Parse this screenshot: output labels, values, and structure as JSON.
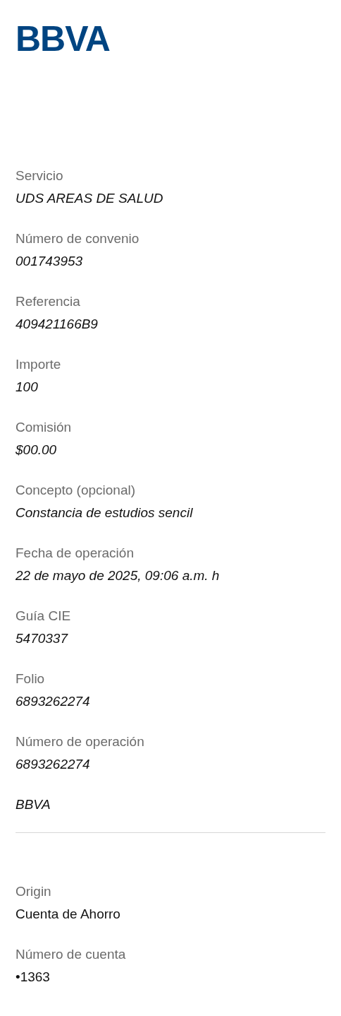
{
  "logo": "BBVA",
  "details": [
    {
      "label": "Servicio",
      "value": "UDS AREAS DE SALUD"
    },
    {
      "label": "Número de convenio",
      "value": "001743953"
    },
    {
      "label": "Referencia",
      "value": "409421166B9"
    },
    {
      "label": "Importe",
      "value": "100"
    },
    {
      "label": "Comisión",
      "value": "$00.00"
    },
    {
      "label": "Concepto (opcional)",
      "value": "Constancia de estudios sencil"
    },
    {
      "label": "Fecha de operación",
      "value": "22 de mayo de 2025, 09:06 a.m. h"
    },
    {
      "label": "Guía CIE",
      "value": "5470337"
    },
    {
      "label": "Folio",
      "value": "6893262274"
    },
    {
      "label": "Número de operación",
      "value": "6893262274"
    }
  ],
  "bank": "BBVA",
  "origin": [
    {
      "label": "Origin",
      "value": "Cuenta de Ahorro"
    },
    {
      "label": "Número de cuenta",
      "value": "•1363"
    }
  ]
}
